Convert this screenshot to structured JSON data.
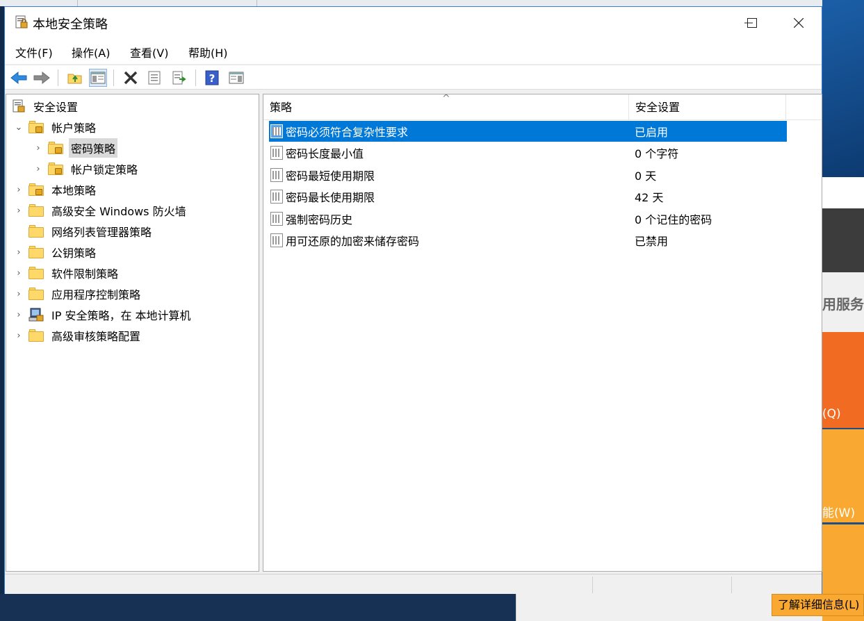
{
  "window": {
    "title": "本地安全策略",
    "controls": {
      "minimize": "—",
      "maximize": "☐",
      "close": "✕"
    }
  },
  "menu": [
    "文件(F)",
    "操作(A)",
    "查看(V)",
    "帮助(H)"
  ],
  "toolbar": {
    "buttons": [
      "back-icon",
      "forward-icon",
      "up-folder-icon",
      "show-hide-tree-icon",
      "delete-icon",
      "properties-icon",
      "export-list-icon",
      "help-icon",
      "show-hide-action-pane-icon"
    ]
  },
  "tree": {
    "root": "安全设置",
    "items": [
      {
        "label": "帐户策略",
        "expanded": true
      },
      {
        "label": "密码策略",
        "selected": true
      },
      {
        "label": "帐户锁定策略"
      },
      {
        "label": "本地策略"
      },
      {
        "label": "高级安全 Windows 防火墙"
      },
      {
        "label": "网络列表管理器策略"
      },
      {
        "label": "公钥策略"
      },
      {
        "label": "软件限制策略"
      },
      {
        "label": "应用程序控制策略"
      },
      {
        "label": "IP 安全策略，在 本地计算机"
      },
      {
        "label": "高级审核策略配置"
      }
    ]
  },
  "list": {
    "columns": [
      "策略",
      "安全设置"
    ],
    "sort_indicator": "^",
    "rows": [
      {
        "policy": "密码必须符合复杂性要求",
        "setting": "已启用",
        "selected": true
      },
      {
        "policy": "密码长度最小值",
        "setting": "0 个字符"
      },
      {
        "policy": "密码最短使用期限",
        "setting": "0 天"
      },
      {
        "policy": "密码最长使用期限",
        "setting": "42 天"
      },
      {
        "policy": "强制密码历史",
        "setting": "0 个记住的密码"
      },
      {
        "policy": "用可还原的加密来储存密码",
        "setting": "已禁用"
      }
    ]
  },
  "background": {
    "right_panel_text": "用服务器",
    "button_q": "(Q)",
    "button_w": "能(W)",
    "learn_more": "了解详细信息(L)"
  },
  "colors": {
    "selection": "#0078d7",
    "orange": "#f26b22",
    "light_orange": "#f9a932"
  }
}
